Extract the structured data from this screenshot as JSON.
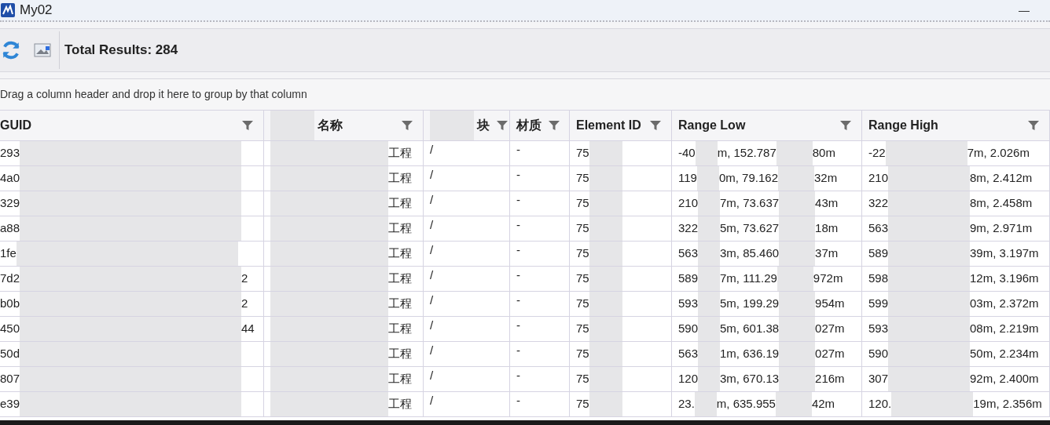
{
  "window": {
    "title": "My02",
    "minimize": "—"
  },
  "toolbar": {
    "total": "Total Results: 284"
  },
  "group_panel": {
    "hint": "Drag a column header and drop it here to group by that column"
  },
  "table": {
    "columns": [
      {
        "parts": [
          "GUID"
        ],
        "hidden_before": false
      },
      {
        "parts": [
          "名称"
        ],
        "hidden_before": true
      },
      {
        "parts": [
          "块"
        ],
        "hidden_before": true
      },
      {
        "parts": [
          "材质"
        ],
        "hidden_before": false
      },
      {
        "parts": [
          "Element ID"
        ],
        "hidden_before": false
      },
      {
        "parts": [
          "Range Low"
        ],
        "hidden_before": false
      },
      {
        "parts": [
          "Range High"
        ],
        "hidden_before": false
      }
    ],
    "rows": [
      {
        "guid": [
          "293"
        ],
        "name": "工程",
        "plot": "/",
        "material": "-",
        "element_id": "75",
        "range_low": [
          "-40",
          "m, 152.787",
          "80m"
        ],
        "range_high": [
          "-22",
          "7m, 2.026m"
        ]
      },
      {
        "guid": [
          "4a0"
        ],
        "name": "工程",
        "plot": "/",
        "material": "-",
        "element_id": "75",
        "range_low": [
          "119",
          "0m, 79.162",
          "32m"
        ],
        "range_high": [
          "210",
          "8m, 2.412m"
        ]
      },
      {
        "guid": [
          "329"
        ],
        "name": "工程",
        "plot": "/",
        "material": "-",
        "element_id": "75",
        "range_low": [
          "210",
          "7m, 73.637",
          "43m"
        ],
        "range_high": [
          "322",
          "8m, 2.458m"
        ]
      },
      {
        "guid": [
          "a88"
        ],
        "name": "工程",
        "plot": "/",
        "material": "-",
        "element_id": "75",
        "range_low": [
          "322",
          "5m, 73.627",
          "18m"
        ],
        "range_high": [
          "563",
          "9m, 2.971m"
        ]
      },
      {
        "guid": [
          "1fe"
        ],
        "name": "工程",
        "plot": "/",
        "material": "-",
        "element_id": "75",
        "range_low": [
          "563",
          "3m, 85.460",
          "37m"
        ],
        "range_high": [
          "589",
          "39m, 3.197m"
        ]
      },
      {
        "guid": [
          "7d2",
          "2"
        ],
        "name": "工程",
        "plot": "/",
        "material": "-",
        "element_id": "75",
        "range_low": [
          "589",
          "7m, 111.29",
          "972m"
        ],
        "range_high": [
          "598",
          "12m, 3.196m"
        ]
      },
      {
        "guid": [
          "b0b",
          "2"
        ],
        "name": "工程",
        "plot": "/",
        "material": "-",
        "element_id": "75",
        "range_low": [
          "593",
          "5m, 199.29",
          "954m"
        ],
        "range_high": [
          "599",
          "03m, 2.372m"
        ]
      },
      {
        "guid": [
          "450",
          "44"
        ],
        "name": "工程",
        "plot": "/",
        "material": "-",
        "element_id": "75",
        "range_low": [
          "590",
          "5m, 601.38",
          "027m"
        ],
        "range_high": [
          "593",
          "08m, 2.219m"
        ]
      },
      {
        "guid": [
          "50d"
        ],
        "name": "工程",
        "plot": "/",
        "material": "-",
        "element_id": "75",
        "range_low": [
          "563",
          "1m, 636.19",
          "027m"
        ],
        "range_high": [
          "590",
          "50m, 2.234m"
        ]
      },
      {
        "guid": [
          "807"
        ],
        "name": "工程",
        "plot": "/",
        "material": "-",
        "element_id": "75",
        "range_low": [
          "120",
          "3m, 670.13",
          "216m"
        ],
        "range_high": [
          "307",
          "92m, 2.400m"
        ]
      },
      {
        "guid": [
          "e39"
        ],
        "name": "工程",
        "plot": "/",
        "material": "-",
        "element_id": "75",
        "range_low": [
          "23.",
          "m, 635.955",
          "42m"
        ],
        "range_high": [
          "120.",
          "19m, 2.356m"
        ]
      }
    ]
  }
}
